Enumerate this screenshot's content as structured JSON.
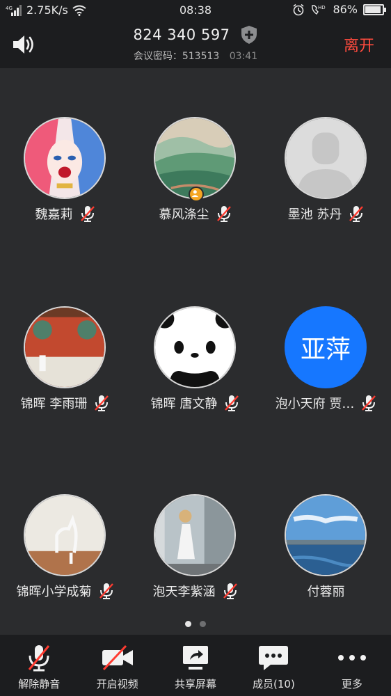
{
  "status_bar": {
    "network_speed": "2.75K/s",
    "time": "08:38",
    "battery_percent": "86%",
    "battery_level": 0.86,
    "signal_label": "4G",
    "hd_label": "HD"
  },
  "header": {
    "meeting_id": "824 340 597",
    "password_label": "会议密码：513513",
    "elapsed": "03:41",
    "leave_label": "离开"
  },
  "participants": [
    {
      "name": "魏嘉莉",
      "muted": true,
      "avatar": "harley-portrait"
    },
    {
      "name": "慕风涤尘",
      "muted": true,
      "avatar": "mountain-landscape",
      "host": true
    },
    {
      "name": "墨池 苏丹",
      "muted": true,
      "avatar": "default-silhouette"
    },
    {
      "name": "锦晖  李雨珊",
      "muted": true,
      "avatar": "red-wall-photo"
    },
    {
      "name": "锦晖 唐文静",
      "muted": true,
      "avatar": "panda-face"
    },
    {
      "name": "泡小天府  贾…",
      "muted": true,
      "avatar": "text-avatar",
      "avatar_text": "亚萍",
      "avatar_color": "#1677ff"
    },
    {
      "name": "锦晖小学成菊",
      "muted": true,
      "avatar": "horse-field-photo"
    },
    {
      "name": "泡天李紫涵",
      "muted": true,
      "avatar": "girl-doorway-photo"
    },
    {
      "name": "付蓉丽",
      "muted": false,
      "avatar": "lake-sky-photo"
    }
  ],
  "pager": {
    "pages": 2,
    "current": 1
  },
  "toolbar": {
    "unmute_label": "解除静音",
    "video_label": "开启视频",
    "share_label": "共享屏幕",
    "members_label": "成员(10)",
    "more_label": "更多"
  },
  "colors": {
    "background": "#2b2c2e",
    "bar": "#1c1d1f",
    "leave": "#ff4b3e",
    "muted_slash": "#ff3b30",
    "host_badge": "#f5a623"
  }
}
